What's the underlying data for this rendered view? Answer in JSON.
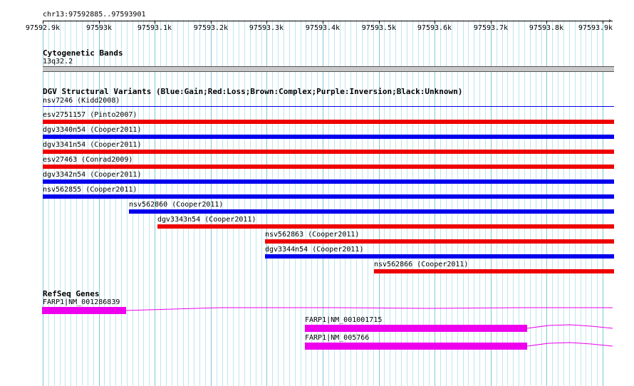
{
  "colors": {
    "gain": "#0000ee",
    "loss": "#ee0000",
    "gene": "#ee00ee",
    "grid_minor": "#bfe6ee",
    "grid_major": "#7fc8d8"
  },
  "ruler": {
    "locus": "chr13:97592885..97593901",
    "ticks": [
      {
        "label": "97592.9k"
      },
      {
        "label": "97593k"
      },
      {
        "label": "97593.1k"
      },
      {
        "label": "97593.2k"
      },
      {
        "label": "97593.3k"
      },
      {
        "label": "97593.4k"
      },
      {
        "label": "97593.5k"
      },
      {
        "label": "97593.6k"
      },
      {
        "label": "97593.7k"
      },
      {
        "label": "97593.8k"
      },
      {
        "label": "97593.9k"
      }
    ]
  },
  "cytoband": {
    "title": "Cytogenetic Bands",
    "band_label": "13q32.2"
  },
  "dgv": {
    "title": "DGV Structural Variants (Blue:Gain;Red:Loss;Brown:Complex;Purple:Inversion;Black:Unknown)",
    "top_label": "nsv7246 (Kidd2008)",
    "variants": [
      {
        "label": "esv2751157 (Pinto2007)",
        "type": "loss"
      },
      {
        "label": "dgv3340n54 (Cooper2011)",
        "type": "gain"
      },
      {
        "label": "dgv3341n54 (Cooper2011)",
        "type": "loss"
      },
      {
        "label": "esv27463 (Conrad2009)",
        "type": "loss"
      },
      {
        "label": "dgv3342n54 (Cooper2011)",
        "type": "gain"
      },
      {
        "label": "nsv562855 (Cooper2011)",
        "type": "gain"
      },
      {
        "label": "nsv562860 (Cooper2011)",
        "type": "gain"
      },
      {
        "label": "dgv3343n54 (Cooper2011)",
        "type": "loss"
      },
      {
        "label": "nsv562863 (Cooper2011)",
        "type": "loss"
      },
      {
        "label": "dgv3344n54 (Cooper2011)",
        "type": "gain"
      },
      {
        "label": "nsv562866 (Cooper2011)",
        "type": "loss"
      }
    ]
  },
  "refseq": {
    "title": "RefSeq Genes",
    "genes": [
      {
        "label": "FARP1|NM_001286839"
      },
      {
        "label": "FARP1|NM_001001715"
      },
      {
        "label": "FARP1|NM_005766"
      }
    ]
  }
}
